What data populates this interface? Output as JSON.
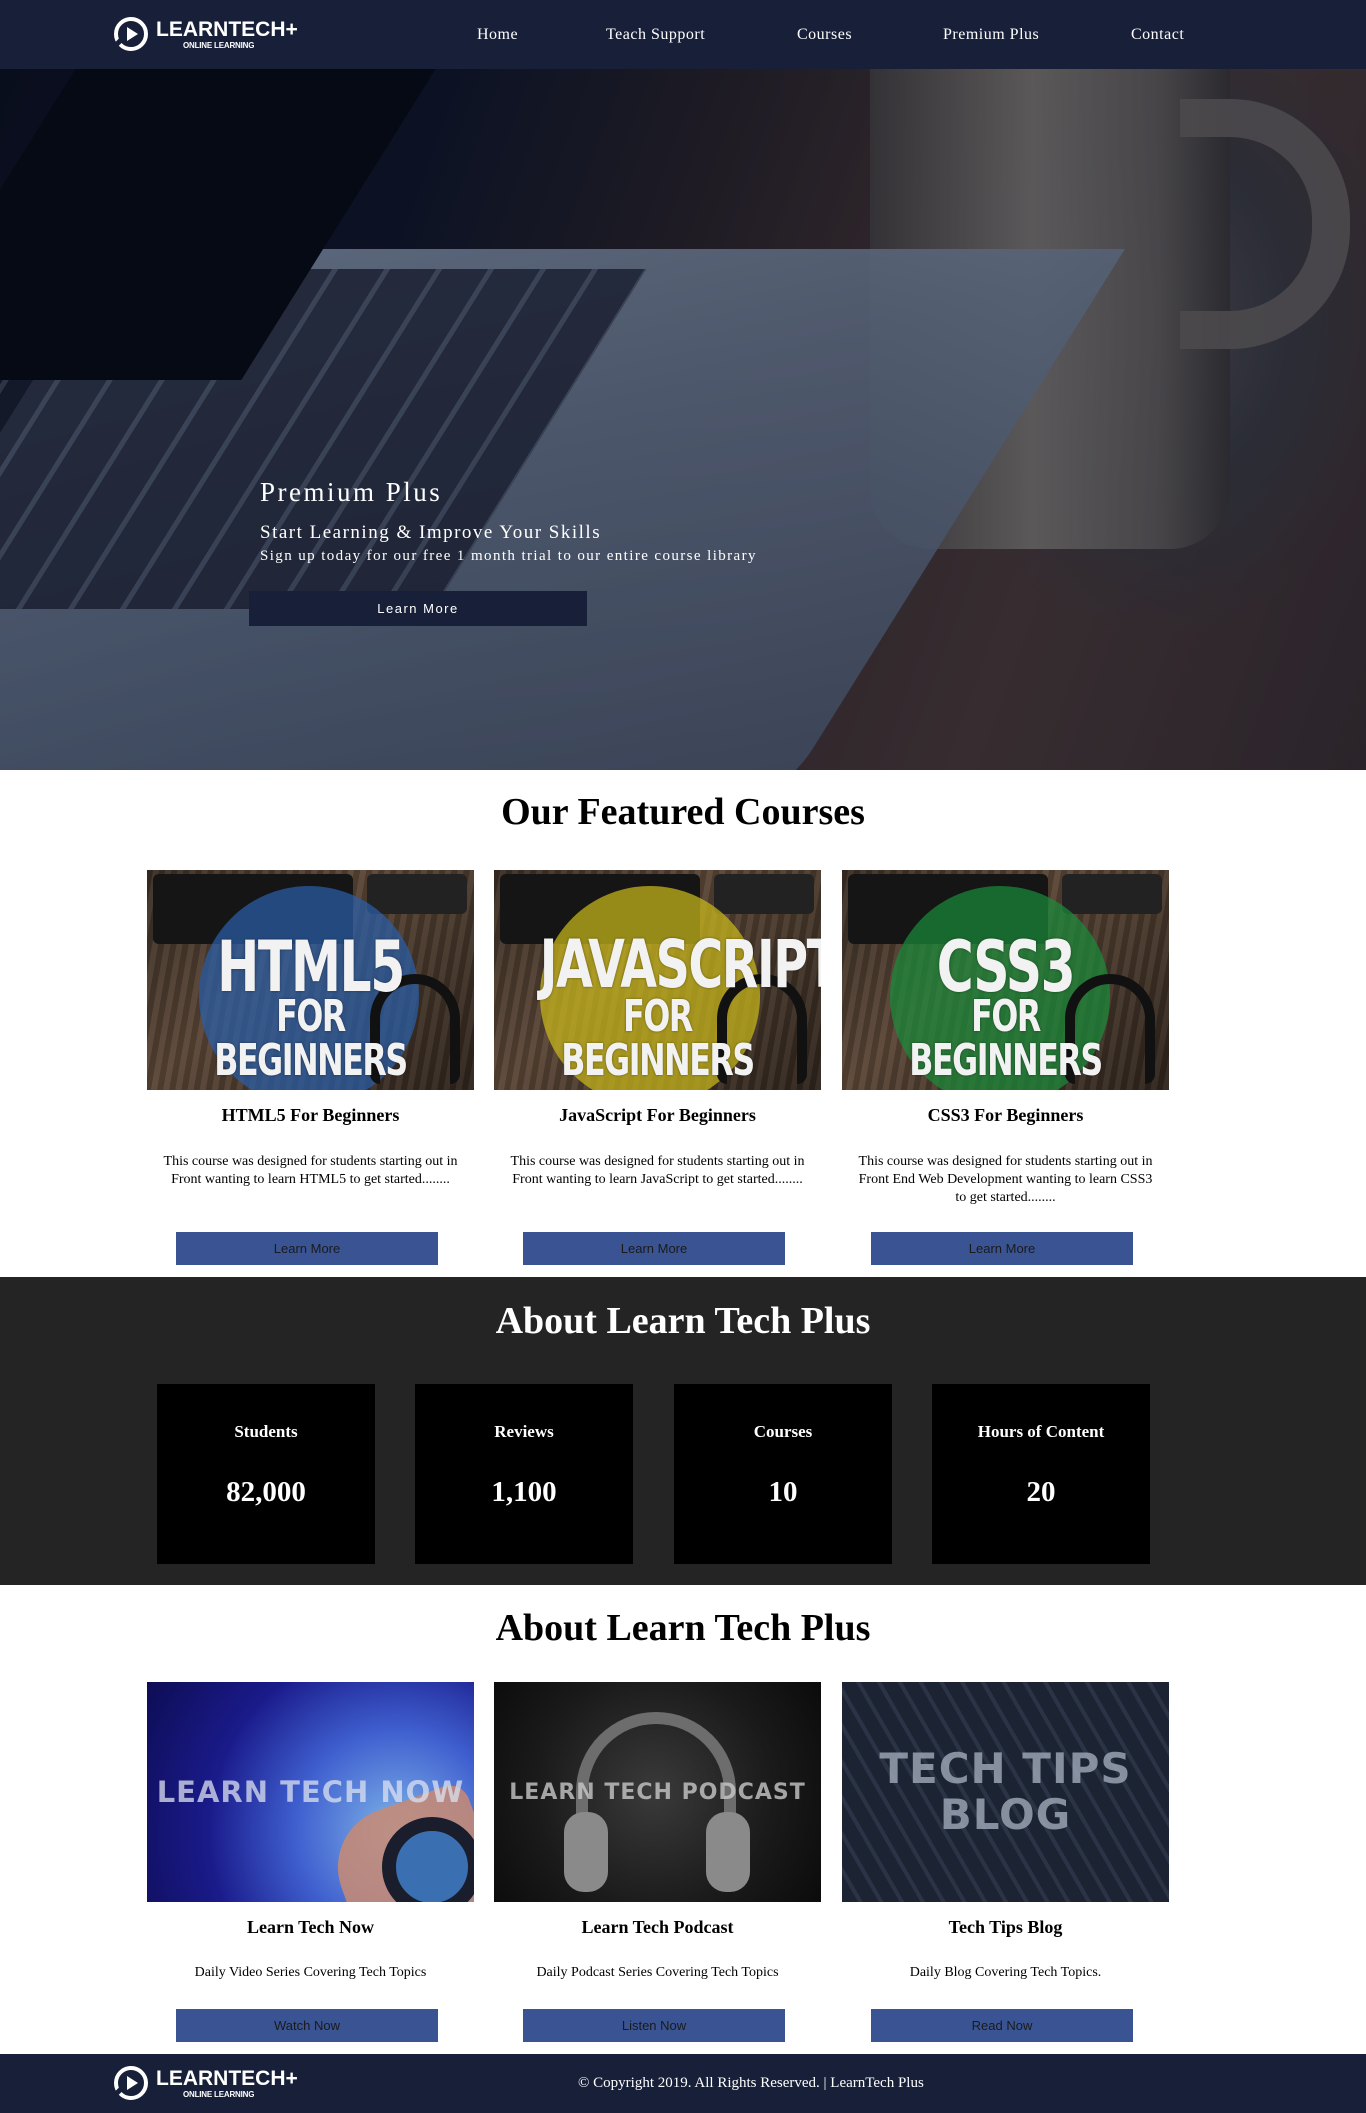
{
  "brand": {
    "name": "LEARNTECH+",
    "tagline": "ONLINE LEARNING"
  },
  "nav": {
    "items": [
      {
        "label": "Home"
      },
      {
        "label": "Teach Support"
      },
      {
        "label": "Courses"
      },
      {
        "label": "Premium Plus"
      },
      {
        "label": "Contact"
      }
    ]
  },
  "hero": {
    "title": "Premium Plus",
    "subtitle": "Start Learning & Improve Your Skills",
    "description": "Sign up today for our free 1 month trial to our entire course library",
    "button_label": "Learn More"
  },
  "featured": {
    "heading": "Our Featured Courses",
    "courses": [
      {
        "image_line1": "HTML5",
        "image_line2": "FOR BEGINNERS",
        "circle_color": "#2a5ea8",
        "title": "HTML5 For Beginners",
        "description": "This course was designed for students starting out in Front wanting to learn HTML5 to get started........",
        "button_label": "Learn More"
      },
      {
        "image_line1": "JAVASCRIPT",
        "image_line2": "FOR BEGINNERS",
        "circle_color": "#c9b81a",
        "title": "JavaScript For Beginners",
        "description": "This course was designed for students starting out in Front wanting to learn JavaScript to get started........",
        "button_label": "Learn More"
      },
      {
        "image_line1": "CSS3",
        "image_line2": "FOR BEGINNERS",
        "circle_color": "#1b8a3a",
        "title": "CSS3 For Beginners",
        "description": "This course was designed for students starting out in Front End Web Development wanting to learn CSS3 to get started........",
        "button_label": "Learn More"
      }
    ]
  },
  "about_stats": {
    "heading": "About Learn Tech Plus",
    "stats": [
      {
        "label": "Students",
        "value": "82,000"
      },
      {
        "label": "Reviews",
        "value": "1,100"
      },
      {
        "label": "Courses",
        "value": "10"
      },
      {
        "label": "Hours of Content",
        "value": "20"
      }
    ]
  },
  "about_media": {
    "heading": "About Learn Tech Plus",
    "items": [
      {
        "image_text": "LEARN TECH NOW",
        "title": "Learn Tech Now",
        "description": "Daily Video Series Covering Tech Topics",
        "button_label": "Watch Now"
      },
      {
        "image_text": "LEARN TECH PODCAST",
        "title": "Learn Tech Podcast",
        "description": "Daily Podcast Series Covering Tech Topics",
        "button_label": "Listen Now"
      },
      {
        "image_text_line1": "TECH TIPS",
        "image_text_line2": "BLOG",
        "title": "Tech Tips Blog",
        "description": "Daily Blog Covering Tech Topics.",
        "button_label": "Read Now"
      }
    ]
  },
  "footer": {
    "copyright": "© Copyright 2019. All Rights Reserved. | LearnTech Plus"
  },
  "colors": {
    "nav_bg": "#182039",
    "button_blue": "#3a5493",
    "stats_bg": "#242424",
    "stat_box": "#000000"
  }
}
